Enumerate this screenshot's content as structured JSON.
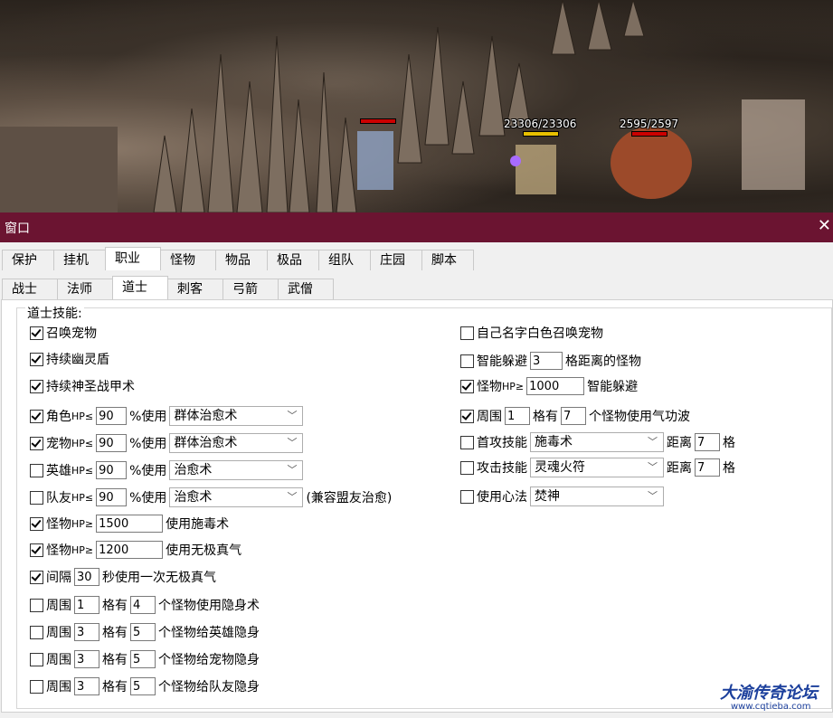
{
  "game": {
    "hp_labels": [
      "23306/23306",
      "2595/2597"
    ]
  },
  "window": {
    "title": "窗口",
    "close": "✕"
  },
  "main_tabs": [
    "保护",
    "挂机",
    "职业",
    "怪物",
    "物品",
    "极品",
    "组队",
    "庄园",
    "脚本"
  ],
  "sub_tabs": [
    "战士",
    "法师",
    "道士",
    "刺客",
    "弓箭",
    "武僧"
  ],
  "group_title": "道士技能:",
  "left": {
    "summon_pet": "召唤宠物",
    "ghost_shield": "持续幽灵盾",
    "holy_armor": "持续神圣战甲术",
    "role_hp": {
      "prefix": "角色",
      "hp": "HP≤",
      "value": "90",
      "use": "%使用",
      "skill": "群体治愈术"
    },
    "pet_hp": {
      "prefix": "宠物",
      "hp": "HP≤",
      "value": "90",
      "use": "%使用",
      "skill": "群体治愈术"
    },
    "hero_hp": {
      "prefix": "英雄",
      "hp": "HP≤",
      "value": "90",
      "use": "%使用",
      "skill": "治愈术"
    },
    "team_hp": {
      "prefix": "队友",
      "hp": "HP≤",
      "value": "90",
      "use": "%使用",
      "skill": "治愈术",
      "note": "(兼容盟友治愈)"
    },
    "monster_poison": {
      "prefix": "怪物",
      "hp": "HP≥",
      "value": "1500",
      "text": "使用施毒术"
    },
    "monster_wuji": {
      "prefix": "怪物",
      "hp": "HP≥",
      "value": "1200",
      "text": "使用无极真气"
    },
    "interval": {
      "label": "间隔",
      "value": "30",
      "text": "秒使用一次无极真气"
    },
    "around1": {
      "label": "周围",
      "v1": "1",
      "mid": "格有",
      "v2": "4",
      "text": "个怪物使用隐身术"
    },
    "around2": {
      "label": "周围",
      "v1": "3",
      "mid": "格有",
      "v2": "5",
      "text": "个怪物给英雄隐身"
    },
    "around3": {
      "label": "周围",
      "v1": "3",
      "mid": "格有",
      "v2": "5",
      "text": "个怪物给宠物隐身"
    },
    "around4": {
      "label": "周围",
      "v1": "3",
      "mid": "格有",
      "v2": "5",
      "text": "个怪物给队友隐身"
    }
  },
  "right": {
    "white_pet": "自己名字白色召唤宠物",
    "smart_dodge": {
      "label": "智能躲避",
      "value": "3",
      "text": "格距离的怪物"
    },
    "monster_dodge": {
      "prefix": "怪物",
      "hp": "HP≥",
      "value": "1000",
      "text": "智能躲避"
    },
    "qigong": {
      "label": "周围",
      "v1": "1",
      "mid": "格有",
      "v2": "7",
      "text": "个怪物使用气功波"
    },
    "first_attack": {
      "label": "首攻技能",
      "skill": "施毒术",
      "dist": "距离",
      "value": "7",
      "unit": "格"
    },
    "attack_skill": {
      "label": "攻击技能",
      "skill": "灵魂火符",
      "dist": "距离",
      "value": "7",
      "unit": "格"
    },
    "heart_method": {
      "label": "使用心法",
      "skill": "焚神"
    }
  },
  "watermark": {
    "name": "大渝传奇论坛",
    "url": "www.cqtieba.com"
  }
}
